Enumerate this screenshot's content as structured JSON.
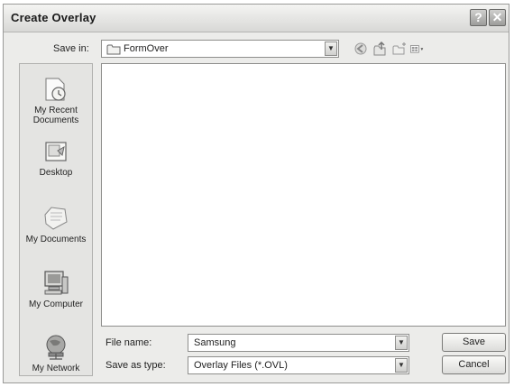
{
  "window": {
    "title": "Create Overlay",
    "help_glyph": "?",
    "close_glyph": "✕"
  },
  "savein": {
    "label": "Save in:",
    "value": "FormOver"
  },
  "places": [
    {
      "id": "recent",
      "label_line1": "My Recent",
      "label_line2": "Documents"
    },
    {
      "id": "desktop",
      "label_line1": "Desktop",
      "label_line2": ""
    },
    {
      "id": "documents",
      "label_line1": "My Documents",
      "label_line2": ""
    },
    {
      "id": "computer",
      "label_line1": "My Computer",
      "label_line2": ""
    },
    {
      "id": "network",
      "label_line1": "My Network",
      "label_line2": ""
    }
  ],
  "filename": {
    "label": "File name:",
    "value": "Samsung"
  },
  "filetype": {
    "label": "Save as type:",
    "value": "Overlay Files (*.OVL)"
  },
  "buttons": {
    "save": "Save",
    "cancel": "Cancel"
  },
  "combo_arrow": "▼",
  "views_arrow": "▾"
}
